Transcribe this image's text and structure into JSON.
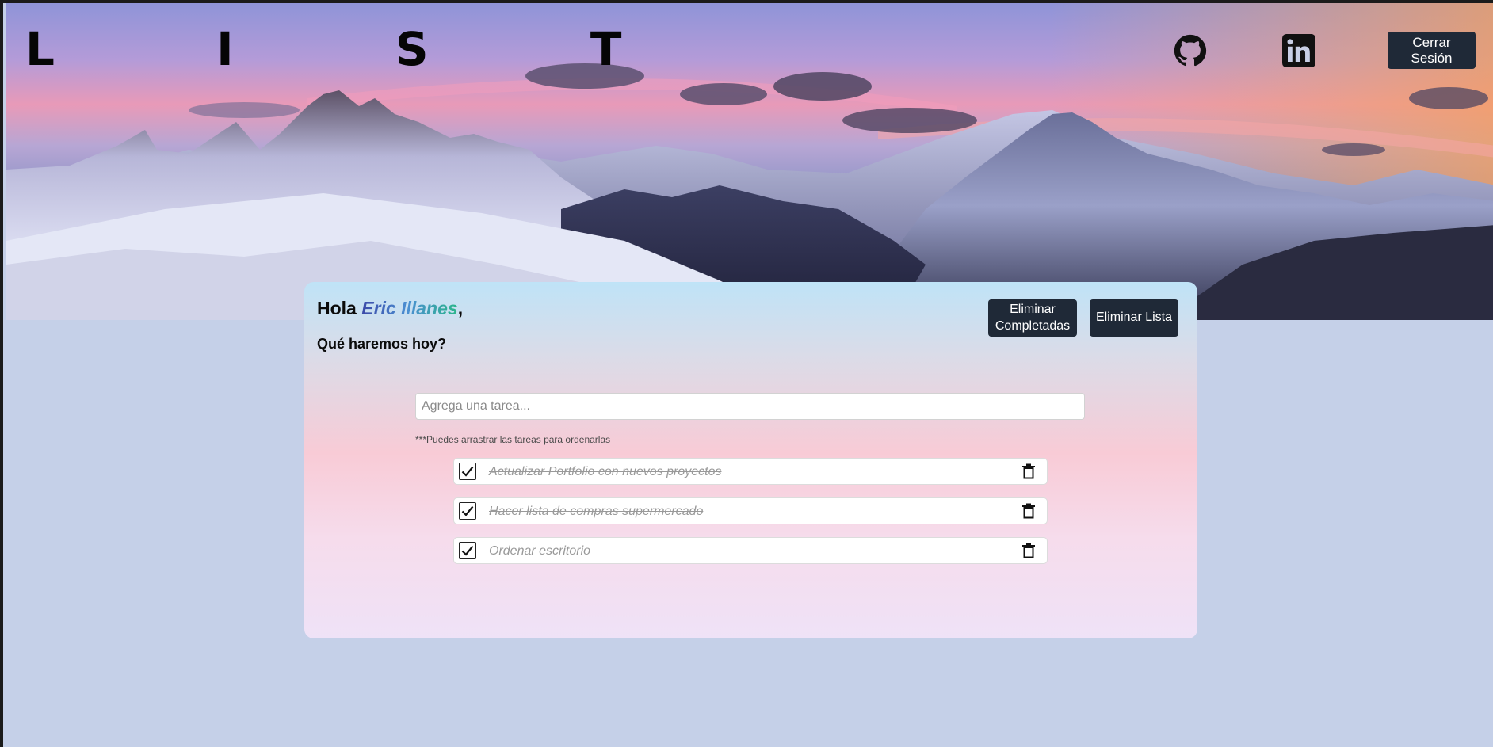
{
  "header": {
    "logo": "L I S T",
    "github_label": "GitHub",
    "linkedin_label": "LinkedIn",
    "logout_label": "Cerrar Sesión"
  },
  "card": {
    "greeting_prefix": "Hola",
    "user_name": "Eric Illanes",
    "greeting_suffix": ",",
    "subtitle": "Qué haremos hoy?",
    "delete_completed_label": "Eliminar Completadas",
    "delete_list_label": "Eliminar Lista",
    "input_placeholder": "Agrega una tarea...",
    "input_value": "",
    "hint": "***Puedes arrastrar las tareas para ordenarlas",
    "tasks": [
      {
        "text": "Actualizar Portfolio con nuevos proyectos",
        "completed": true
      },
      {
        "text": "Hacer lista de compras supermercado",
        "completed": true
      },
      {
        "text": "Ordenar escritorio",
        "completed": true
      }
    ]
  },
  "colors": {
    "page_background": "#c5d0e8",
    "button_dark": "#1f2937",
    "name_gradient": [
      "#3b49a8",
      "#4b8fd2",
      "#2bb58a"
    ],
    "card_gradient": [
      "#bfe3f7",
      "#f8cbd6",
      "#efe2f7"
    ]
  },
  "icons": [
    "github-icon",
    "linkedin-icon",
    "checkmark-icon",
    "trash-icon"
  ]
}
